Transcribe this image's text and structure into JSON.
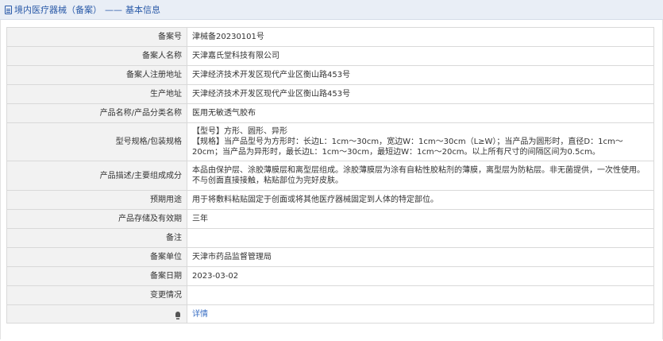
{
  "header": {
    "title": "境内医疗器械（备案）",
    "separator": "——",
    "subtitle": "基本信息"
  },
  "rows": [
    {
      "label": "备案号",
      "value": "津械备20230101号"
    },
    {
      "label": "备案人名称",
      "value": "天津嘉氏堂科技有限公司"
    },
    {
      "label": "备案人注册地址",
      "value": "天津经济技术开发区现代产业区衡山路453号"
    },
    {
      "label": "生产地址",
      "value": "天津经济技术开发区现代产业区衡山路453号"
    },
    {
      "label": "产品名称/产品分类名称",
      "value": "医用无敏透气胶布"
    },
    {
      "label": "型号规格/包装规格",
      "value_lines": [
        "【型号】方形、圆形、异形",
        "【规格】当产品型号为方形时：长边L：1cm～30cm，宽边W：1cm～30cm（L≥W）；当产品为圆形时，直径D：1cm～20cm；当产品为异形时，最长边L：1cm～30cm，最短边W：1cm～20cm。以上所有尺寸的间隔区间为0.5cm。"
      ]
    },
    {
      "label": "产品描述/主要组成成分",
      "value": "本品由保护层、涂胶薄膜层和离型层组成。涂胶薄膜层为涂有自粘性胶粘剂的薄膜，离型层为防粘层。非无菌提供，一次性使用。不与创面直接接触，粘贴部位为完好皮肤。"
    },
    {
      "label": "预期用途",
      "value": "用于将敷料粘贴固定于创面或将其他医疗器械固定到人体的特定部位。"
    },
    {
      "label": "产品存储及有效期",
      "value": "三年"
    },
    {
      "label": "备注",
      "value": ""
    },
    {
      "label": "备案单位",
      "value": "天津市药品监督管理局"
    },
    {
      "label": "备案日期",
      "value": "2023-03-02"
    },
    {
      "label": "变更情况",
      "value": ""
    },
    {
      "label": "",
      "value": "详情"
    }
  ]
}
